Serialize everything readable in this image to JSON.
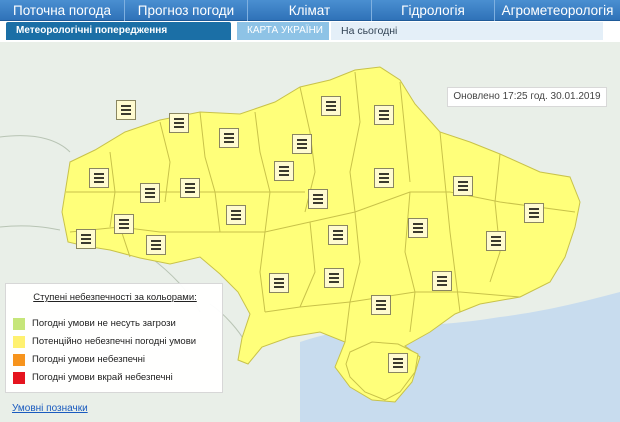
{
  "nav": {
    "items": [
      {
        "label": "Поточна погода"
      },
      {
        "label": "Прогноз погоди"
      },
      {
        "label": "Клімат"
      },
      {
        "label": "Гідрологія"
      },
      {
        "label": "Агрометеорологія"
      }
    ]
  },
  "subtabs": {
    "active_label": "Метеорологічні попередження",
    "map_label": "КАРТА УКРАЇНИ ▸",
    "today_label": "На сьогодні"
  },
  "map": {
    "updated_text": "Оновлено 17:25 год. 30.01.2019",
    "warning_level_all_regions": "Потенційно небезпечні погодні умови",
    "region_count": 25,
    "colors": {
      "sea": "#c8dcee",
      "neighbors": "#e9efe8",
      "ukraine": "#ffff7a",
      "borders": "#c8c24a"
    }
  },
  "legend": {
    "title": "Ступені небезпечності за кольорами:",
    "items": [
      {
        "label": "Погодні умови не несуть загрози",
        "color": "#c6e67a"
      },
      {
        "label": "Потенційно небезпечні погодні умови",
        "color": "#fff170"
      },
      {
        "label": "Погодні умови небезпечні",
        "color": "#f7941d"
      },
      {
        "label": "Погодні умови вкрай небезпечні",
        "color": "#e5141e"
      }
    ]
  },
  "links": {
    "symbols": "Умовні позначки"
  }
}
